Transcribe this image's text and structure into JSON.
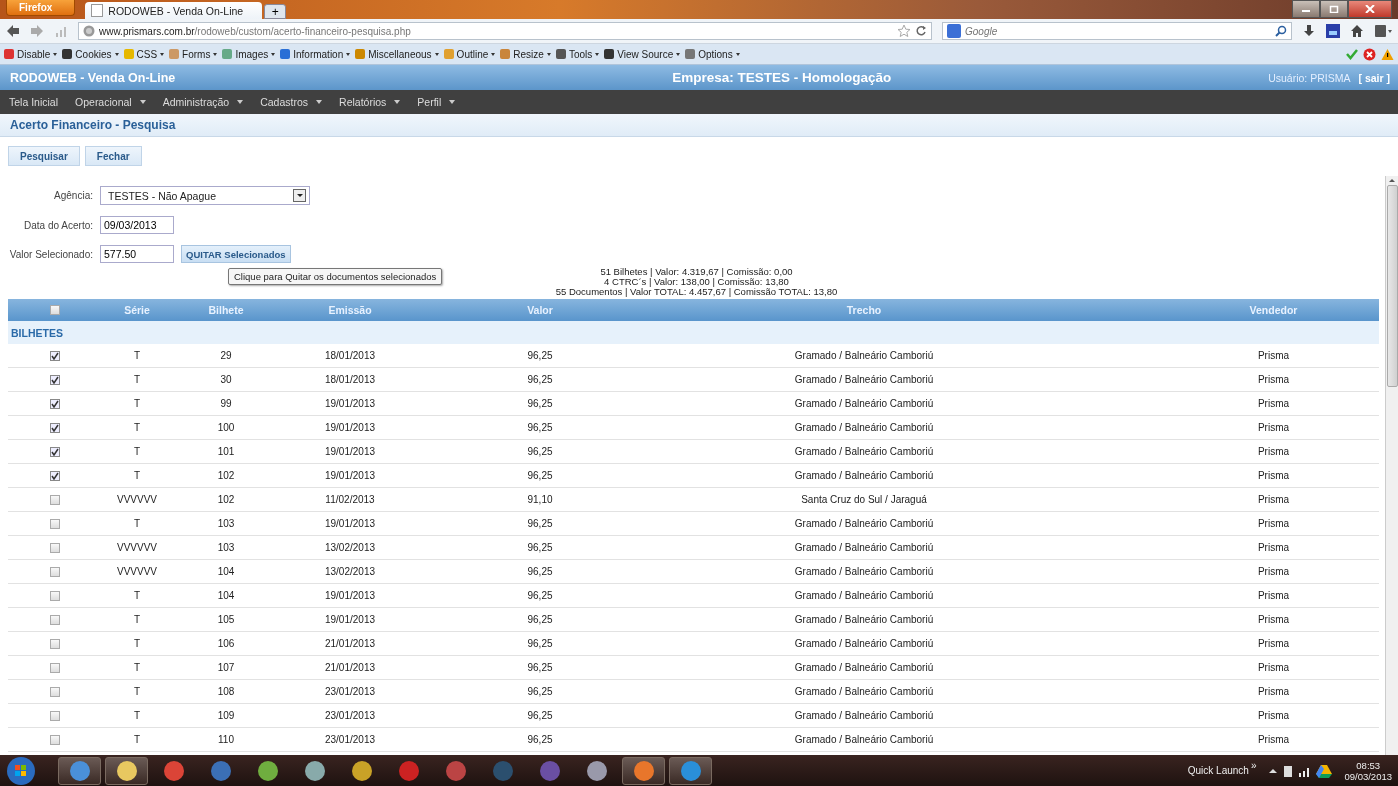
{
  "browser": {
    "menu_button": "Firefox",
    "tab_title": "RODOWEB - Venda On-Line",
    "new_tab": "+",
    "url_domain": "www.prismars.com.br",
    "url_path": "/rodoweb/custom/acerto-financeiro-pesquisa.php",
    "search_placeholder": "Google",
    "toolbar": [
      "Disable",
      "Cookies",
      "CSS",
      "Forms",
      "Images",
      "Information",
      "Miscellaneous",
      "Outline",
      "Resize",
      "Tools",
      "View Source",
      "Options"
    ]
  },
  "header": {
    "app_title": "RODOWEB - Venda On-Line",
    "company": "Empresa: TESTES - Homologação",
    "user": "Usuário: PRISMA",
    "logout": "[ sair ]"
  },
  "menu": [
    {
      "label": "Tela Inicial",
      "has_dropdown": false
    },
    {
      "label": "Operacional",
      "has_dropdown": true
    },
    {
      "label": "Administração",
      "has_dropdown": true
    },
    {
      "label": "Cadastros",
      "has_dropdown": true
    },
    {
      "label": "Relatórios",
      "has_dropdown": true
    },
    {
      "label": "Perfil",
      "has_dropdown": true
    }
  ],
  "page_title": "Acerto Financeiro - Pesquisa",
  "actions": [
    "Pesquisar",
    "Fechar"
  ],
  "form": {
    "agencia_label": "Agência:",
    "agencia_value": "TESTES - Não Apague",
    "data_label": "Data do Acerto:",
    "data_value": "09/03/2013",
    "valor_label": "Valor Selecionado:",
    "valor_value": "577.50",
    "quitar_button": "QUITAR Selecionados",
    "tooltip": "Clique para Quitar os documentos selecionados"
  },
  "summary": [
    "51 Bilhetes | Valor: 4.319,67 | Comissão: 0,00",
    "4 CTRC´s | Valor: 138,00 | Comissão: 13,80",
    "55 Documentos | Valor TOTAL: 4.457,67 | Comissão TOTAL: 13,80"
  ],
  "table": {
    "select_all_checked": false,
    "columns": [
      "Série",
      "Bilhete",
      "Emissão",
      "Valor",
      "Trecho",
      "Vendedor"
    ],
    "group": "BILHETES",
    "rows": [
      {
        "checked": true,
        "serie": "T",
        "bilhete": "29",
        "emissao": "18/01/2013",
        "valor": "96,25",
        "trecho": "Gramado / Balneário Camboriú",
        "vendedor": "Prisma"
      },
      {
        "checked": true,
        "serie": "T",
        "bilhete": "30",
        "emissao": "18/01/2013",
        "valor": "96,25",
        "trecho": "Gramado / Balneário Camboriú",
        "vendedor": "Prisma"
      },
      {
        "checked": true,
        "serie": "T",
        "bilhete": "99",
        "emissao": "19/01/2013",
        "valor": "96,25",
        "trecho": "Gramado / Balneário Camboriú",
        "vendedor": "Prisma"
      },
      {
        "checked": true,
        "serie": "T",
        "bilhete": "100",
        "emissao": "19/01/2013",
        "valor": "96,25",
        "trecho": "Gramado / Balneário Camboriú",
        "vendedor": "Prisma"
      },
      {
        "checked": true,
        "serie": "T",
        "bilhete": "101",
        "emissao": "19/01/2013",
        "valor": "96,25",
        "trecho": "Gramado / Balneário Camboriú",
        "vendedor": "Prisma"
      },
      {
        "checked": true,
        "serie": "T",
        "bilhete": "102",
        "emissao": "19/01/2013",
        "valor": "96,25",
        "trecho": "Gramado / Balneário Camboriú",
        "vendedor": "Prisma"
      },
      {
        "checked": false,
        "serie": "VVVVVV",
        "bilhete": "102",
        "emissao": "11/02/2013",
        "valor": "91,10",
        "trecho": "Santa Cruz do Sul / Jaraguá",
        "vendedor": "Prisma"
      },
      {
        "checked": false,
        "serie": "T",
        "bilhete": "103",
        "emissao": "19/01/2013",
        "valor": "96,25",
        "trecho": "Gramado / Balneário Camboriú",
        "vendedor": "Prisma"
      },
      {
        "checked": false,
        "serie": "VVVVVV",
        "bilhete": "103",
        "emissao": "13/02/2013",
        "valor": "96,25",
        "trecho": "Gramado / Balneário Camboriú",
        "vendedor": "Prisma"
      },
      {
        "checked": false,
        "serie": "VVVVVV",
        "bilhete": "104",
        "emissao": "13/02/2013",
        "valor": "96,25",
        "trecho": "Gramado / Balneário Camboriú",
        "vendedor": "Prisma"
      },
      {
        "checked": false,
        "serie": "T",
        "bilhete": "104",
        "emissao": "19/01/2013",
        "valor": "96,25",
        "trecho": "Gramado / Balneário Camboriú",
        "vendedor": "Prisma"
      },
      {
        "checked": false,
        "serie": "T",
        "bilhete": "105",
        "emissao": "19/01/2013",
        "valor": "96,25",
        "trecho": "Gramado / Balneário Camboriú",
        "vendedor": "Prisma"
      },
      {
        "checked": false,
        "serie": "T",
        "bilhete": "106",
        "emissao": "21/01/2013",
        "valor": "96,25",
        "trecho": "Gramado / Balneário Camboriú",
        "vendedor": "Prisma"
      },
      {
        "checked": false,
        "serie": "T",
        "bilhete": "107",
        "emissao": "21/01/2013",
        "valor": "96,25",
        "trecho": "Gramado / Balneário Camboriú",
        "vendedor": "Prisma"
      },
      {
        "checked": false,
        "serie": "T",
        "bilhete": "108",
        "emissao": "23/01/2013",
        "valor": "96,25",
        "trecho": "Gramado / Balneário Camboriú",
        "vendedor": "Prisma"
      },
      {
        "checked": false,
        "serie": "T",
        "bilhete": "109",
        "emissao": "23/01/2013",
        "valor": "96,25",
        "trecho": "Gramado / Balneário Camboriú",
        "vendedor": "Prisma"
      },
      {
        "checked": false,
        "serie": "T",
        "bilhete": "110",
        "emissao": "23/01/2013",
        "valor": "96,25",
        "trecho": "Gramado / Balneário Camboriú",
        "vendedor": "Prisma"
      }
    ]
  },
  "taskbar": {
    "quick_launch": "Quick Launch",
    "chevron": "»",
    "time": "08:53",
    "date": "09/03/2013"
  }
}
